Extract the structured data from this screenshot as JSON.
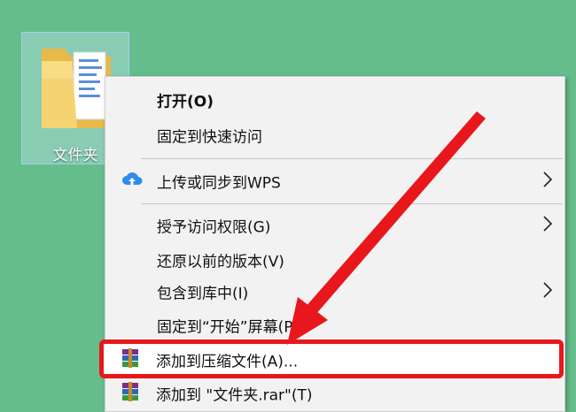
{
  "desktop": {
    "background_color": "#66bd8c",
    "folder": {
      "label": "文件夹",
      "icon": "folder-icon"
    }
  },
  "context_menu": {
    "items": [
      {
        "label": "打开(O)",
        "bold": true
      },
      {
        "label": "固定到快速访问"
      },
      {
        "label": "上传或同步到WPS",
        "icon": "wps-cloud-upload-icon",
        "submenu": true
      },
      {
        "label": "授予访问权限(G)",
        "submenu": true
      },
      {
        "label": "还原以前的版本(V)"
      },
      {
        "label": "包含到库中(I)",
        "submenu": true
      },
      {
        "label": "固定到“开始”屏幕(P)"
      },
      {
        "label": "添加到压缩文件(A)...",
        "icon": "winrar-icon",
        "highlighted": true
      },
      {
        "label": "添加到 \"文件夹.rar\"(T)",
        "icon": "winrar-icon"
      }
    ]
  },
  "annotation": {
    "color": "#e8171c",
    "shape": "red-arrow-pointing-to-highlighted-item"
  }
}
